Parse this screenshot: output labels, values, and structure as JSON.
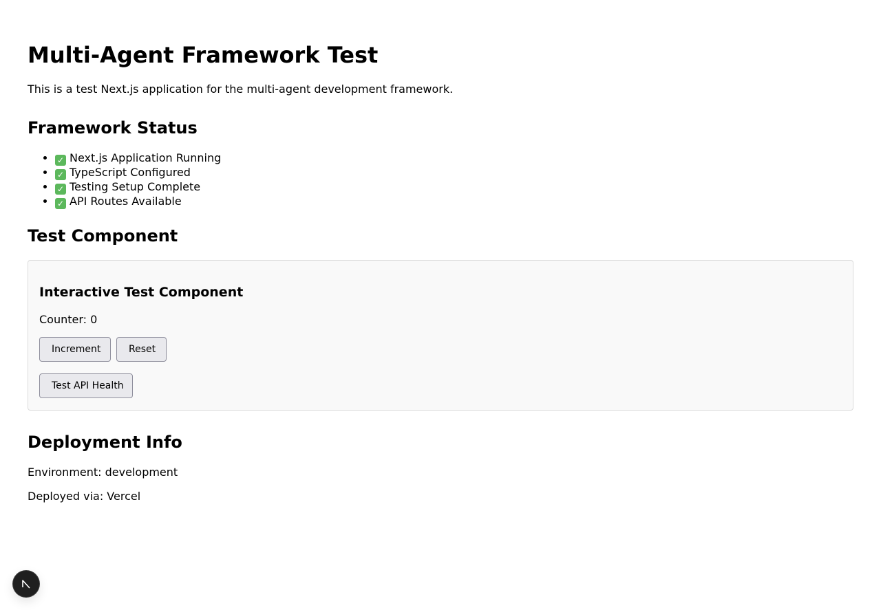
{
  "header": {
    "title": "Multi-Agent Framework Test",
    "intro": "This is a test Next.js application for the multi-agent development framework."
  },
  "status": {
    "heading": "Framework Status",
    "items": [
      {
        "icon": "check-mark-icon",
        "label": "Next.js Application Running"
      },
      {
        "icon": "check-mark-icon",
        "label": "TypeScript Configured"
      },
      {
        "icon": "check-mark-icon",
        "label": "Testing Setup Complete"
      },
      {
        "icon": "check-mark-icon",
        "label": "API Routes Available"
      }
    ]
  },
  "test_component": {
    "heading": "Test Component",
    "card_title": "Interactive Test Component",
    "counter_label": "Counter: 0",
    "buttons": {
      "increment": "Increment",
      "reset": "Reset",
      "api_health": "Test API Health"
    }
  },
  "deployment": {
    "heading": "Deployment Info",
    "environment": "Environment: development",
    "deployed_via": "Deployed via: Vercel"
  },
  "dev_badge": {
    "icon": "nextjs-logo-icon"
  },
  "colors": {
    "check": "#5cb85c",
    "card_bg": "#f9f9f9",
    "button_bg": "#e9e9ed",
    "badge_bg": "#1f1f1f"
  }
}
